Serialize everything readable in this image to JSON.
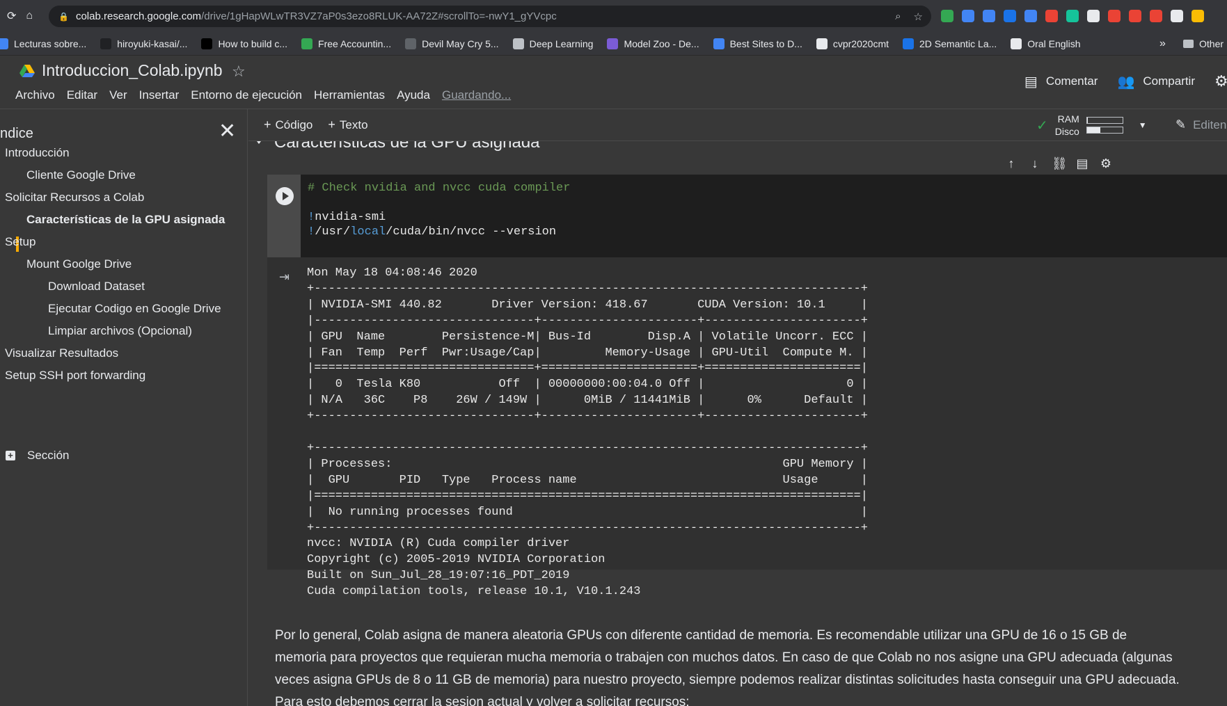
{
  "browser": {
    "url_host": "colab.research.google.com",
    "url_path": "/drive/1gHapWLwTR3VZ7aP0s3ezo8RLUK-AA72Z#scrollTo=-nwY1_gYVcpc",
    "extension_colors": [
      "#34a853",
      "#4285f4",
      "#4285f4",
      "#1a73e8",
      "#4285f4",
      "#ea4335",
      "#15c39a",
      "#e8eaed",
      "#ea4335",
      "#ea4335",
      "#ea4335",
      "#e8eaed",
      "#fbbc04"
    ]
  },
  "bookmarks": {
    "items": [
      {
        "label": "Lecturas sobre...",
        "icon": "book-icon",
        "color": "#4285f4"
      },
      {
        "label": "hiroyuki-kasai/...",
        "icon": "github-icon",
        "color": "#202124"
      },
      {
        "label": "How to build c...",
        "icon": "medium-icon",
        "color": "#000000"
      },
      {
        "label": "Free Accountin...",
        "icon": "circle-icon",
        "color": "#34a853"
      },
      {
        "label": "Devil May Cry 5...",
        "icon": "doc-icon",
        "color": "#5f6368"
      },
      {
        "label": "Deep Learning",
        "icon": "folder-icon",
        "color": "#bdc1c6"
      },
      {
        "label": "Model Zoo - De...",
        "icon": "m-icon",
        "color": "#7b5cd6"
      },
      {
        "label": "Best Sites to D...",
        "icon": "site-icon",
        "color": "#4285f4"
      },
      {
        "label": "cvpr2020cmt",
        "icon": "globe-icon",
        "color": "#e8eaed"
      },
      {
        "label": "2D Semantic La...",
        "icon": "page-icon",
        "color": "#1a73e8"
      },
      {
        "label": "Oral English",
        "icon": "globe-icon",
        "color": "#e8eaed"
      }
    ],
    "more": "»",
    "other": "Other"
  },
  "header": {
    "title": "Introduccion_Colab.ipynb",
    "menu": [
      "Archivo",
      "Editar",
      "Ver",
      "Insertar",
      "Entorno de ejecución",
      "Herramientas",
      "Ayuda"
    ],
    "saving": "Guardando...",
    "comment": "Comentar",
    "share": "Compartir"
  },
  "sidebar": {
    "title": "ndice",
    "items": [
      {
        "label": "Introducción",
        "level": 1
      },
      {
        "label": "Cliente Google Drive",
        "level": 2
      },
      {
        "label": "Solicitar Recursos a Colab",
        "level": 1
      },
      {
        "label": "Características de la GPU asignada",
        "level": 2,
        "active": true
      },
      {
        "label": "Setup",
        "level": 1
      },
      {
        "label": "Mount Goolge Drive",
        "level": 2
      },
      {
        "label": "Download Dataset",
        "level": 3
      },
      {
        "label": "Ejecutar Codigo en Google Drive",
        "level": 3
      },
      {
        "label": "Limpiar archivos (Opcional)",
        "level": 3
      },
      {
        "label": "Visualizar Resultados",
        "level": 1
      },
      {
        "label": "Setup SSH port forwarding",
        "level": 1
      }
    ],
    "section_button": "Sección"
  },
  "toolbar": {
    "code_button": "Código",
    "text_button": "Texto",
    "ram_label": "RAM",
    "disk_label": "Disco",
    "ram_fraction": 0.03,
    "disk_fraction": 0.38,
    "edit_label": "Editen"
  },
  "notebook": {
    "section_heading": "Características de la GPU asignada",
    "code_lines": {
      "comment": "# Check nvidia and nvcc cuda compiler",
      "line2_bang": "!",
      "line2_rest": "nvidia-smi",
      "line3_bang": "!",
      "line3_a": "/usr/",
      "line3_kw": "local",
      "line3_b": "/cuda/bin/nvcc --version"
    },
    "output": "Mon May 18 04:08:46 2020\n+-----------------------------------------------------------------------------+\n| NVIDIA-SMI 440.82       Driver Version: 418.67       CUDA Version: 10.1     |\n|-------------------------------+----------------------+----------------------+\n| GPU  Name        Persistence-M| Bus-Id        Disp.A | Volatile Uncorr. ECC |\n| Fan  Temp  Perf  Pwr:Usage/Cap|         Memory-Usage | GPU-Util  Compute M. |\n|===============================+======================+======================|\n|   0  Tesla K80           Off  | 00000000:00:04.0 Off |                    0 |\n| N/A   36C    P8    26W / 149W |      0MiB / 11441MiB |      0%      Default |\n+-------------------------------+----------------------+----------------------+\n\n+-----------------------------------------------------------------------------+\n| Processes:                                                       GPU Memory |\n|  GPU       PID   Type   Process name                             Usage      |\n|=============================================================================|\n|  No running processes found                                                 |\n+-----------------------------------------------------------------------------+\nnvcc: NVIDIA (R) Cuda compiler driver\nCopyright (c) 2005-2019 NVIDIA Corporation\nBuilt on Sun_Jul_28_19:07:16_PDT_2019\nCuda compilation tools, release 10.1, V10.1.243",
    "markdown": "Por lo general, Colab asigna de manera aleatoria GPUs con diferente cantidad de memoria. Es recomendable utilizar una GPU de 16 o 15 GB de memoria para proyectos que requieran mucha memoria o trabajen con muchos datos. En caso de que Colab no nos asigne una GPU adecuada (algunas veces asigna GPUs de 8 o 11 GB de memoria) para nuestro proyecto, siempre podemos realizar distintas solicitudes hasta conseguir una GPU adecuada. Para esto debemos cerrar la sesion actual y volver a solicitar recursos:"
  }
}
